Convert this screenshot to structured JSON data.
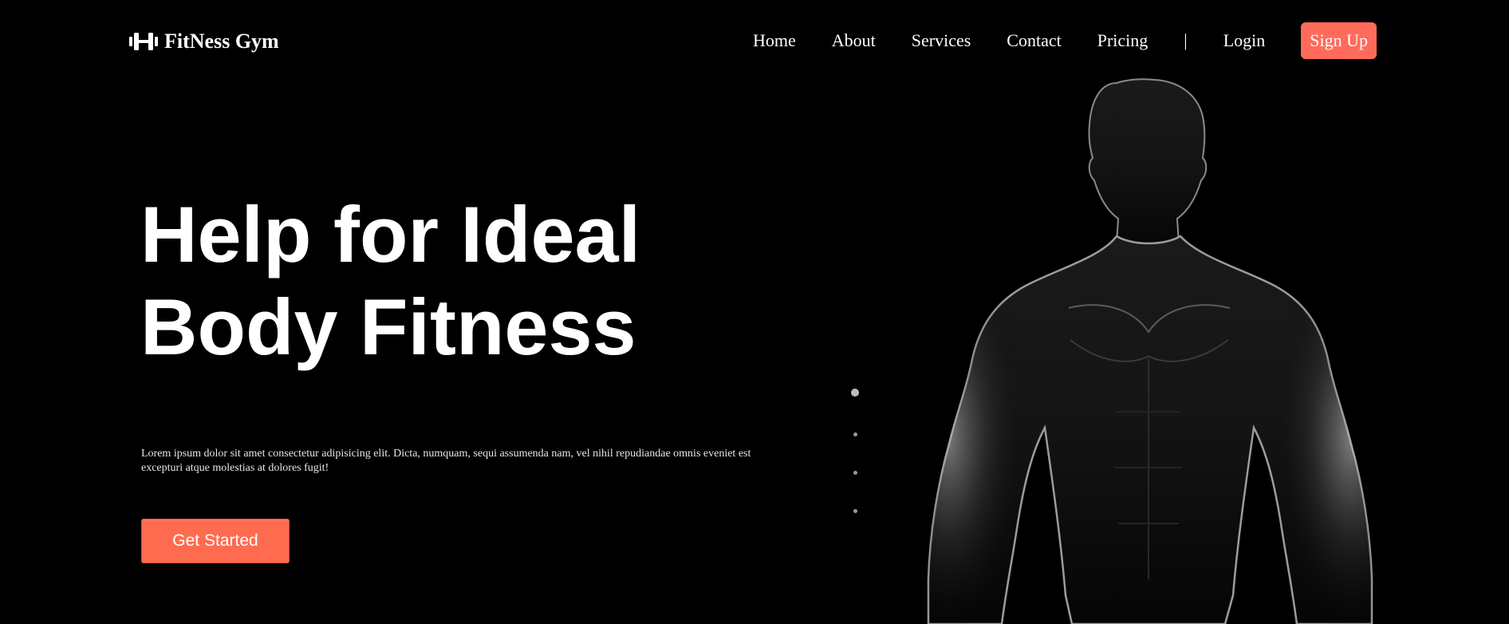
{
  "header": {
    "brand": "FitNess Gym",
    "logo_icon": "dumbbell-icon",
    "nav": [
      {
        "label": "Home"
      },
      {
        "label": "About"
      },
      {
        "label": "Services"
      },
      {
        "label": "Contact"
      },
      {
        "label": "Pricing"
      }
    ],
    "separator": "|",
    "login_label": "Login",
    "signup_label": "Sign Up"
  },
  "hero": {
    "title": "Help for Ideal\nBody Fitness",
    "description": "Lorem ipsum dolor sit amet consectetur adipisicing elit. Dicta, numquam, sequi assumenda nam, vel nihil repudiandae omnis eveniet est excepturi atque molestias at dolores fugit!",
    "cta_label": "Get Started",
    "image": "athlete-silhouette"
  },
  "slider": {
    "count": 4,
    "active_index": 0
  },
  "colors": {
    "background": "#000000",
    "accent": "#ff6b5b",
    "text": "#ffffff"
  }
}
